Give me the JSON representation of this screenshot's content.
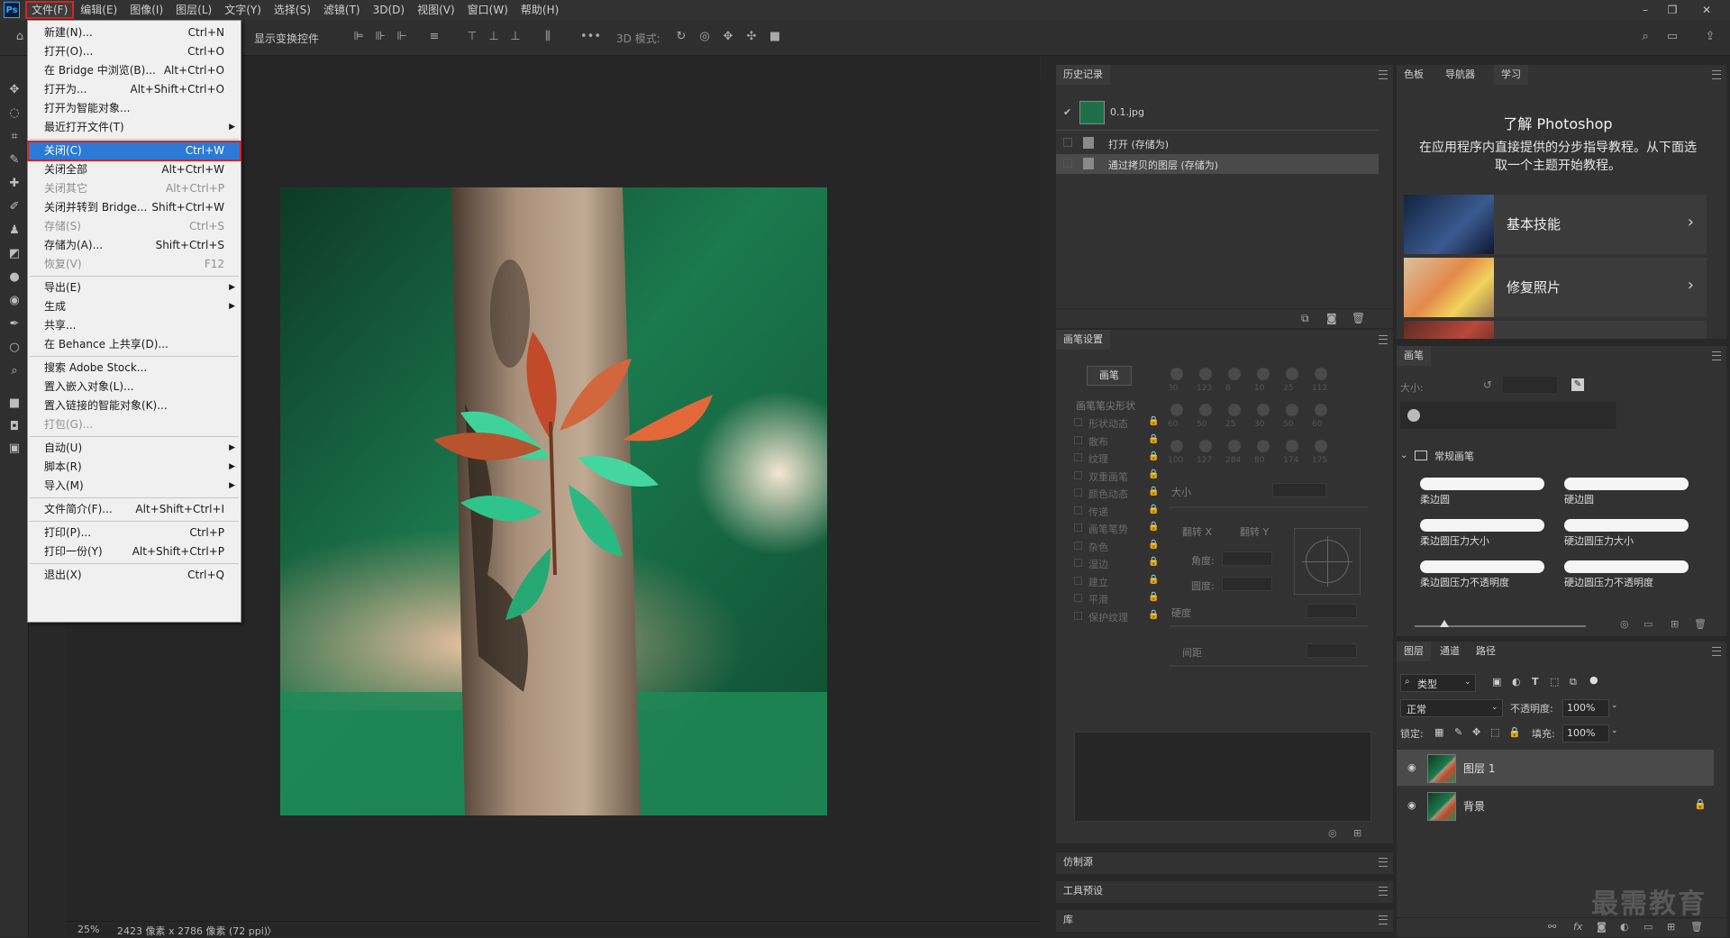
{
  "app": {
    "logo": "Ps"
  },
  "menubar": {
    "items": [
      "文件(F)",
      "编辑(E)",
      "图像(I)",
      "图层(L)",
      "文字(Y)",
      "选择(S)",
      "滤镜(T)",
      "3D(D)",
      "视图(V)",
      "窗口(W)",
      "帮助(H)"
    ],
    "active_index": 0
  },
  "window_controls": {
    "minimize": "–",
    "restore": "❐",
    "close": "✕"
  },
  "options_bar": {
    "show_transform": "显示变换控件",
    "mode3d": "3D 模式:"
  },
  "file_menu": {
    "items": [
      {
        "label": "新建(N)...",
        "shortcut": "Ctrl+N",
        "disabled": false
      },
      {
        "label": "打开(O)...",
        "shortcut": "Ctrl+O",
        "disabled": false
      },
      {
        "label": "在 Bridge 中浏览(B)...",
        "shortcut": "Alt+Ctrl+O",
        "disabled": false
      },
      {
        "label": "打开为...",
        "shortcut": "Alt+Shift+Ctrl+O",
        "disabled": false
      },
      {
        "label": "打开为智能对象...",
        "shortcut": "",
        "disabled": false
      },
      {
        "label": "最近打开文件(T)",
        "shortcut": "",
        "disabled": false,
        "submenu": true
      },
      {
        "label": "关闭(C)",
        "shortcut": "Ctrl+W",
        "disabled": false,
        "highlighted": true
      },
      {
        "label": "关闭全部",
        "shortcut": "Alt+Ctrl+W",
        "disabled": false
      },
      {
        "label": "关闭其它",
        "shortcut": "Alt+Ctrl+P",
        "disabled": true
      },
      {
        "label": "关闭并转到 Bridge...",
        "shortcut": "Shift+Ctrl+W",
        "disabled": false
      },
      {
        "label": "存储(S)",
        "shortcut": "Ctrl+S",
        "disabled": true
      },
      {
        "label": "存储为(A)...",
        "shortcut": "Shift+Ctrl+S",
        "disabled": false
      },
      {
        "label": "恢复(V)",
        "shortcut": "F12",
        "disabled": true
      },
      {
        "label": "导出(E)",
        "shortcut": "",
        "disabled": false,
        "submenu": true
      },
      {
        "label": "生成",
        "shortcut": "",
        "disabled": false,
        "submenu": true
      },
      {
        "label": "共享...",
        "shortcut": "",
        "disabled": false
      },
      {
        "label": "在 Behance 上共享(D)...",
        "shortcut": "",
        "disabled": false
      },
      {
        "label": "搜索 Adobe Stock...",
        "shortcut": "",
        "disabled": false
      },
      {
        "label": "置入嵌入对象(L)...",
        "shortcut": "",
        "disabled": false
      },
      {
        "label": "置入链接的智能对象(K)...",
        "shortcut": "",
        "disabled": false
      },
      {
        "label": "打包(G)...",
        "shortcut": "",
        "disabled": true
      },
      {
        "label": "自动(U)",
        "shortcut": "",
        "disabled": false,
        "submenu": true
      },
      {
        "label": "脚本(R)",
        "shortcut": "",
        "disabled": false,
        "submenu": true
      },
      {
        "label": "导入(M)",
        "shortcut": "",
        "disabled": false,
        "submenu": true
      },
      {
        "label": "文件简介(F)...",
        "shortcut": "Alt+Shift+Ctrl+I",
        "disabled": false
      },
      {
        "label": "打印(P)...",
        "shortcut": "Ctrl+P",
        "disabled": false
      },
      {
        "label": "打印一份(Y)",
        "shortcut": "Alt+Shift+Ctrl+P",
        "disabled": false
      },
      {
        "label": "退出(X)",
        "shortcut": "Ctrl+Q",
        "disabled": false
      }
    ]
  },
  "status": {
    "zoom": "25%",
    "doc_info": "2423 像素 x 2786 像素 (72 ppi)",
    "arrow": "〉"
  },
  "history_panel": {
    "tab": "历史记录",
    "snapshot": "0.1.jpg",
    "states": [
      "打开 (存储为)",
      "通过拷贝的图层 (存储为)"
    ]
  },
  "brush_settings_panel": {
    "tab": "画笔设置",
    "brush_button": "画笔",
    "tip_shape": "画笔笔尖形状",
    "options": [
      "形状动态",
      "散布",
      "纹理",
      "双重画笔",
      "颜色动态",
      "传递",
      "画笔笔势",
      "杂色",
      "湿边",
      "建立",
      "平滑",
      "保护纹理"
    ],
    "tip_sizes": [
      "30",
      "123",
      "8",
      "10",
      "25",
      "112",
      "60",
      "50",
      "25",
      "30",
      "50",
      "60",
      "100",
      "127",
      "284",
      "80",
      "174",
      "175"
    ],
    "size_label": "大小",
    "flip_x": "翻转 X",
    "flip_y": "翻转 Y",
    "angle_label": "角度:",
    "roundness_label": "圆度:",
    "hardness_label": "硬度",
    "spacing_label": "间距"
  },
  "clone_source": {
    "tab": "仿制源"
  },
  "tool_presets": {
    "tab": "工具预设"
  },
  "library": {
    "tab": "库"
  },
  "learn_panel": {
    "tabs": [
      "色板",
      "导航器",
      "学习"
    ],
    "active_tab": 2,
    "title": "了解 Photoshop",
    "desc": "在应用程序内直接提供的分步指导教程。从下面选取一个主题开始教程。",
    "tutorials": [
      "基本技能",
      "修复照片"
    ]
  },
  "brushes_panel": {
    "tab": "画笔",
    "size_label": "大小:",
    "group": "常规画笔",
    "brushes": [
      "柔边圆",
      "硬边圆",
      "柔边圆压力大小",
      "硬边圆压力大小",
      "柔边圆压力不透明度",
      "硬边圆压力不透明度"
    ]
  },
  "layers_panel": {
    "tabs": [
      "图层",
      "通道",
      "路径"
    ],
    "filter": "类型",
    "blend_mode": "正常",
    "opacity_label": "不透明度:",
    "opacity": "100%",
    "lock_label": "锁定:",
    "fill_label": "填充:",
    "fill": "100%",
    "layers": [
      {
        "name": "图层 1",
        "selected": true,
        "locked": false
      },
      {
        "name": "背景",
        "selected": false,
        "locked": true
      }
    ]
  },
  "watermark": "最需教育"
}
